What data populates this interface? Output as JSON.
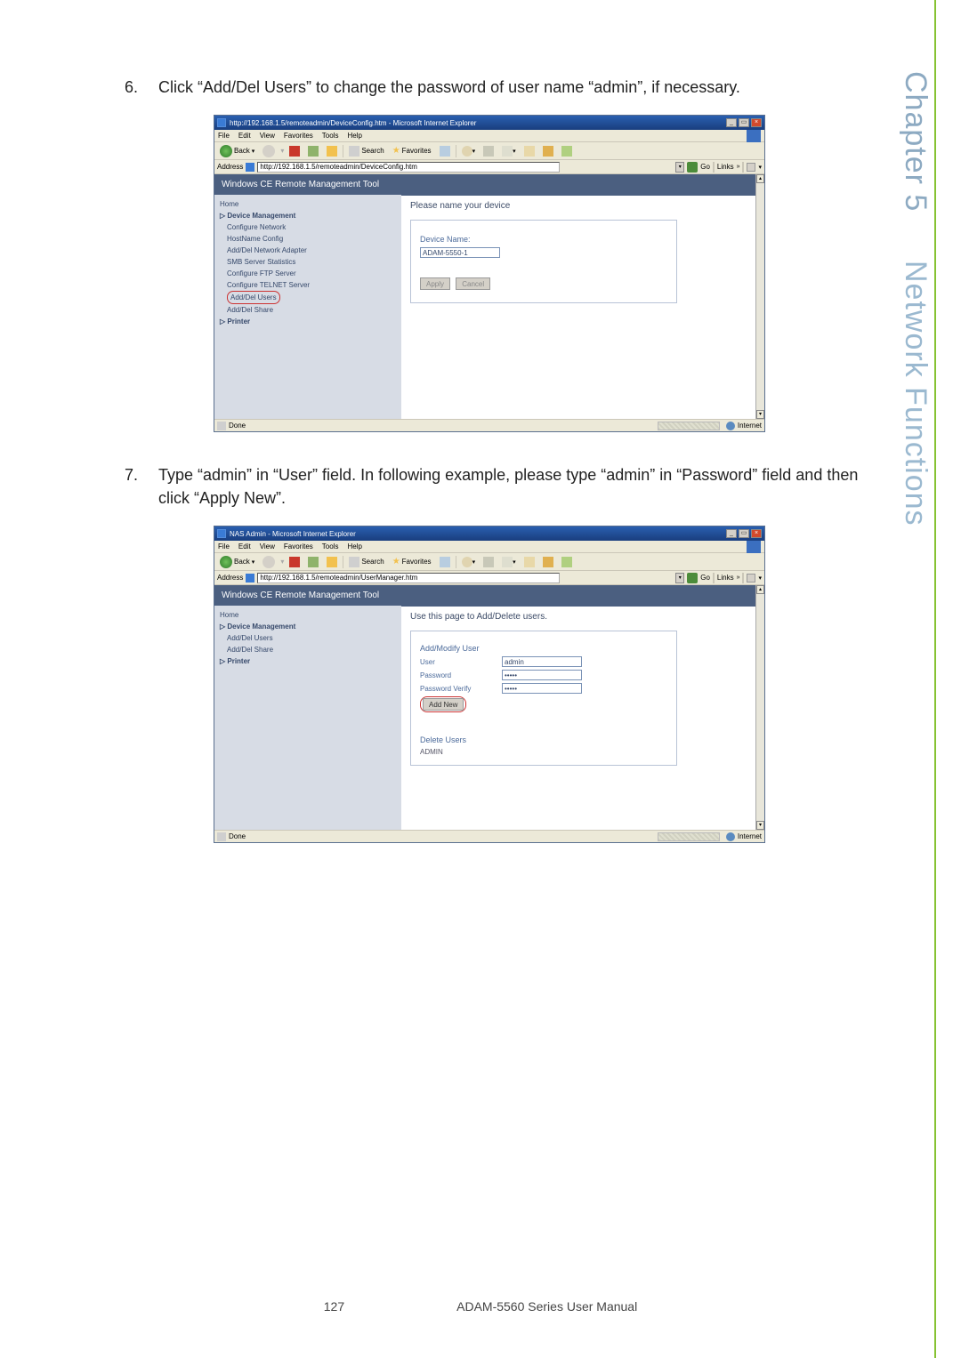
{
  "side_heading": {
    "chapter": "Chapter 5",
    "title": "Network Functions"
  },
  "step6": {
    "num": "6.",
    "text": "Click “Add/Del Users” to change the password of user name “admin”, if necessary."
  },
  "step7": {
    "num": "7.",
    "text": "Type “admin” in “User” field. In following example, please type “admin” in “Password” field and then click “Apply New”."
  },
  "browser_common": {
    "menu": [
      "File",
      "Edit",
      "View",
      "Favorites",
      "Tools",
      "Help"
    ],
    "toolbar": {
      "back": "Back",
      "search": "Search",
      "favorites": "Favorites"
    },
    "address_label": "Address",
    "go_label": "Go",
    "links_label": "Links",
    "status_done": "Done",
    "status_zone": "Internet",
    "wce_header": "Windows CE Remote Management Tool"
  },
  "shot1": {
    "title": "http://192.168.1.5/remoteadmin/DeviceConfig.htm - Microsoft Internet Explorer",
    "address": "http://192.168.1.5/remoteadmin/DeviceConfig.htm",
    "sidebar": {
      "home": "Home",
      "dev_mgmt": "▷ Device Management",
      "items": [
        "Configure Network",
        "HostName Config",
        "Add/Del Network Adapter",
        "SMB Server Statistics",
        "Configure FTP Server",
        "Configure TELNET Server"
      ],
      "add_del_users": "Add/Del Users",
      "add_del_share": "Add/Del Share",
      "printer": "▷ Printer"
    },
    "main": {
      "heading": "Please name your device",
      "form_label": "Device Name:",
      "value": "ADAM-5550-1",
      "apply": "Apply",
      "cancel": "Cancel"
    }
  },
  "shot2": {
    "title": "NAS Admin - Microsoft Internet Explorer",
    "address": "http://192.168.1.5/remoteadmin/UserManager.htm",
    "sidebar": {
      "home": "Home",
      "dev_mgmt": "▷ Device Management",
      "add_del_users": "Add/Del Users",
      "add_del_share": "Add/Del Share",
      "printer": "▷ Printer"
    },
    "main": {
      "heading": "Use this page to Add/Delete users.",
      "sect1": "Add/Modify User",
      "user_lbl": "User",
      "user_val": "admin",
      "pw_lbl": "Password",
      "pw_val": "•••••",
      "pv_lbl": "Password Verify",
      "pv_val": "•••••",
      "add_new": "Add New",
      "sect2": "Delete Users",
      "del_item": "ADMIN"
    }
  },
  "footer": {
    "page": "127",
    "doc": "ADAM-5560 Series User Manual"
  }
}
